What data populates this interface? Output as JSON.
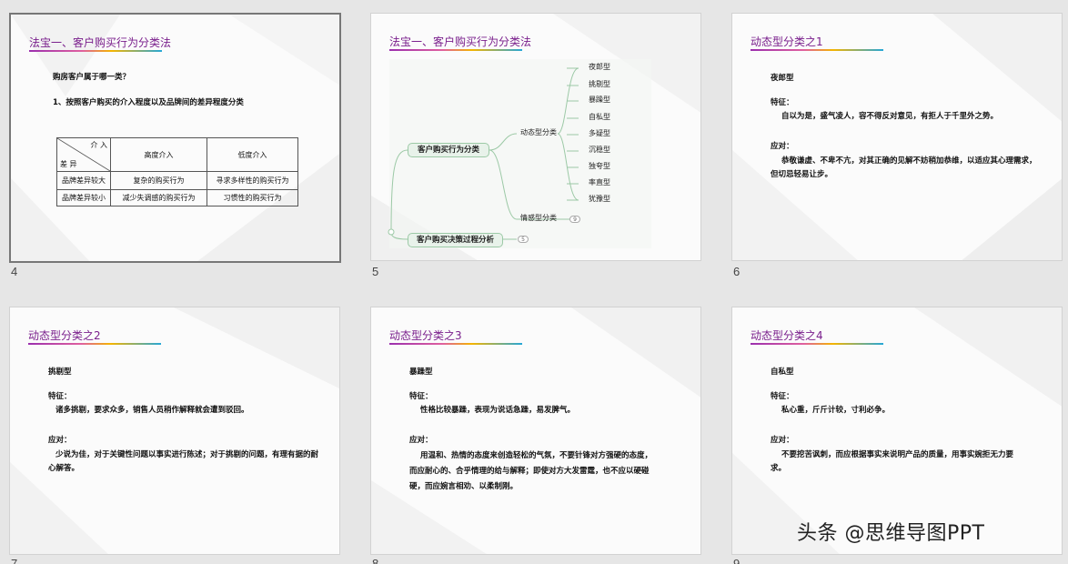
{
  "slides": [
    {
      "number": "4",
      "title": "法宝一、客户购买行为分类法",
      "q1": "购房客户属于哪一类？",
      "q2": "1、按照客户购买的介入程度以及品牌间的差异程度分类",
      "table": {
        "corner_top": "介 入",
        "corner_bottom": "差 异",
        "col1": "高度介入",
        "col2": "低度介入",
        "rows": [
          [
            "品牌差异较大",
            "复杂的购买行为",
            "寻求多样性的购买行为"
          ],
          [
            "品牌差异较小",
            "减少失调感的购买行为",
            "习惯性的购买行为"
          ]
        ]
      }
    },
    {
      "number": "5",
      "title": "法宝一、客户购买行为分类法",
      "mindmap": {
        "main1": "客户购买行为分类",
        "main2": "客户购买决策过程分析",
        "main2_badge": "5",
        "branch_dynamic": "动态型分类",
        "branch_emotion": "情感型分类",
        "emotion_badge": "9",
        "leaves": [
          "夜郎型",
          "挑剔型",
          "暴躁型",
          "自私型",
          "多疑型",
          "沉稳型",
          "独夸型",
          "率直型",
          "犹豫型"
        ]
      }
    },
    {
      "number": "6",
      "title": "动态型分类之1",
      "type_name": "夜郎型",
      "feature_label": "特征：",
      "feature_text": "自以为是，盛气凌人，容不得反对意见，有拒人于千里外之势。",
      "response_label": "应对：",
      "response_text": "恭敬谦虚、不卑不亢，对其正确的见解不妨稍加恭维，以适应其心理需求，但切忌轻易让步。"
    },
    {
      "number": "7",
      "title": "动态型分类之2",
      "type_name": "挑剔型",
      "feature_label": "特征：",
      "feature_text": "诸多挑剔，要求众多，销售人员稍作解释就会遭到驳回。",
      "response_label": "应对：",
      "response_text": "少说为佳，对于关键性问题以事实进行陈述；对于挑剔的问题，有理有据的耐心解答。"
    },
    {
      "number": "8",
      "title": "动态型分类之3",
      "type_name": "暴躁型",
      "feature_label": "特征：",
      "feature_text": "性格比较暴躁，表现为说话急躁，易发脾气。",
      "response_label": "应对：",
      "response_text": "用温和、热情的态度来创造轻松的气氛，不要针锋对方强硬的态度，而应耐心的、合乎情理的给与解释；即使对方大发雷霆，也不应以硬碰硬，而应婉言相劝、以柔制刚。"
    },
    {
      "number": "9",
      "title": "动态型分类之4",
      "type_name": "自私型",
      "feature_label": "特征：",
      "feature_text": "私心重，斤斤计较，寸利必争。",
      "response_label": "应对：",
      "response_text": "不要挖苦讽刺，而应根据事实来说明产品的质量，用事实婉拒无力要求。"
    }
  ],
  "watermark": "头条 @思维导图PPT"
}
